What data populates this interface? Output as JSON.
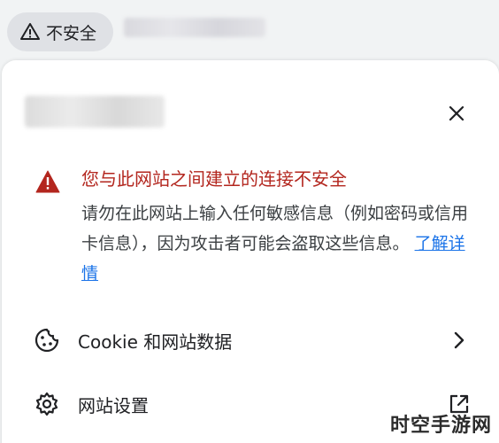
{
  "address_bar": {
    "security_chip_label": "不安全"
  },
  "popup": {
    "alert": {
      "title": "您与此网站之间建立的连接不安全",
      "body": "请勿在此网站上输入任何敏感信息（例如密码或信用卡信息），因为攻击者可能会盗取这些信息。",
      "learn_more": "了解详情"
    },
    "rows": {
      "cookie_label": "Cookie 和网站数据",
      "settings_label": "网站设置"
    }
  },
  "watermark": "时空手游网",
  "colors": {
    "warning_red": "#b3261e",
    "link_blue": "#1a73e8",
    "chip_bg": "#dfe1e5"
  }
}
